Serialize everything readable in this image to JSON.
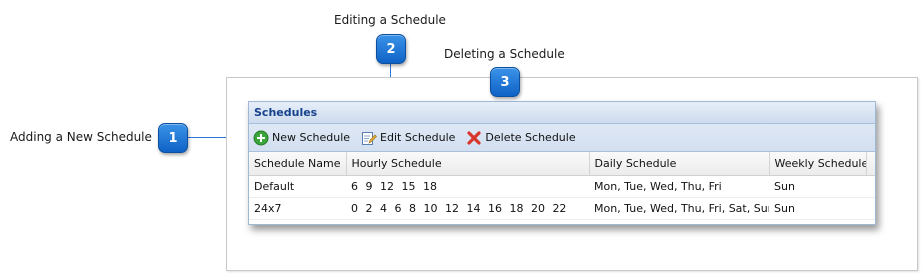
{
  "callouts": {
    "c1": {
      "number": "1",
      "label": "Adding a New Schedule"
    },
    "c2": {
      "number": "2",
      "label": "Editing a Schedule"
    },
    "c3": {
      "number": "3",
      "label": "Deleting a Schedule"
    }
  },
  "panel": {
    "title": "Schedules",
    "toolbar": {
      "new_label": "New Schedule",
      "edit_label": "Edit Schedule",
      "delete_label": "Delete Schedule"
    },
    "columns": [
      "Schedule Name",
      "Hourly Schedule",
      "Daily Schedule",
      "Weekly Schedule"
    ],
    "rows": [
      [
        "Default",
        "6 9 12 15 18",
        "Mon, Tue, Wed, Thu, Fri",
        "Sun"
      ],
      [
        "24x7",
        "0 2 4 6 8 10 12 14 16 18 20 22",
        "Mon, Tue, Wed, Thu, Fri, Sat, Sun",
        "Sun"
      ]
    ]
  },
  "colors": {
    "marker": "#1a74d8",
    "header_text": "#15428b",
    "add_icon": "#3aa63a",
    "delete_icon": "#d9362b"
  }
}
